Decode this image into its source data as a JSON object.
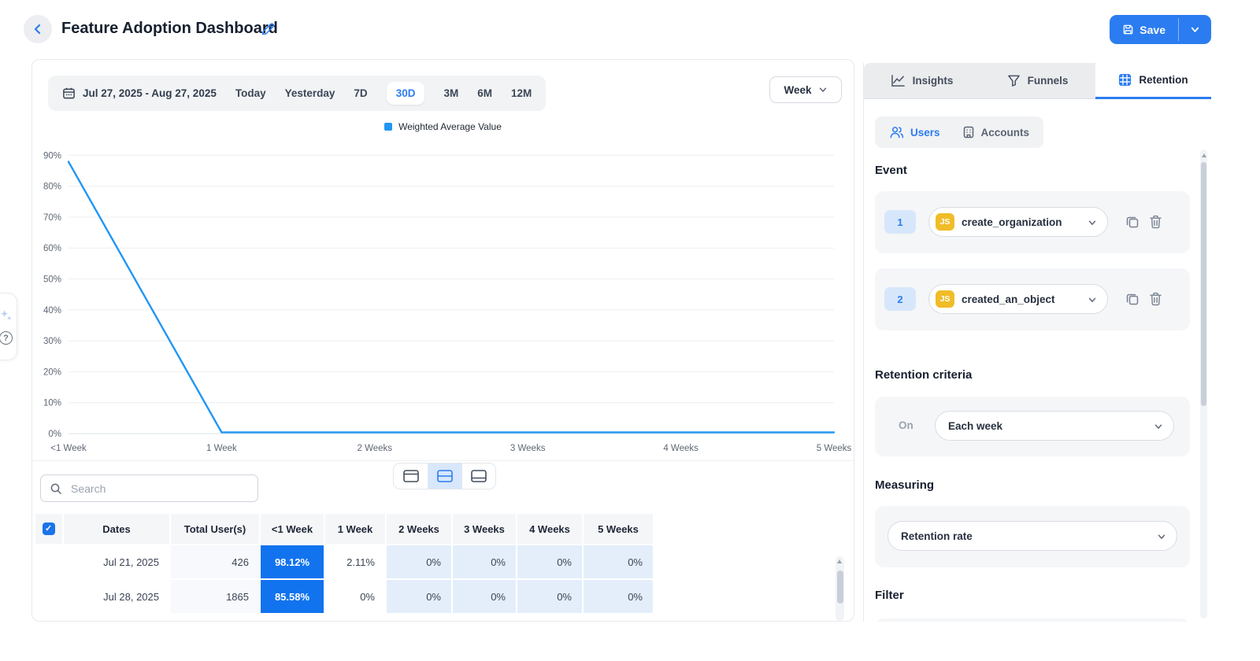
{
  "header": {
    "title": "Feature Adoption Dashboard",
    "save_label": "Save"
  },
  "toolbar": {
    "date_range": "Jul 27, 2025 - Aug 27, 2025",
    "presets": [
      "Today",
      "Yesterday",
      "7D",
      "30D",
      "3M",
      "6M",
      "12M"
    ],
    "active_preset": "30D",
    "granularity": "Week"
  },
  "legend": {
    "label": "Weighted Average Value",
    "color": "#2196f3"
  },
  "chart_data": {
    "type": "line",
    "title": "",
    "x": [
      "<1 Week",
      "1 Week",
      "2 Weeks",
      "3 Weeks",
      "4 Weeks",
      "5 Weeks"
    ],
    "series": [
      {
        "name": "Weighted Average Value",
        "color": "#2196f3",
        "values": [
          87.9,
          0.4,
          0.4,
          0.4,
          0.4,
          0.4
        ]
      }
    ],
    "ylim": [
      0,
      90
    ],
    "yticks": [
      "0%",
      "10%",
      "20%",
      "30%",
      "40%",
      "50%",
      "60%",
      "70%",
      "80%",
      "90%"
    ],
    "grid": true,
    "legend_position": "top-center"
  },
  "table": {
    "search_placeholder": "Search",
    "headers": [
      "Dates",
      "Total User(s)",
      "<1 Week",
      "1 Week",
      "2 Weeks",
      "3 Weeks",
      "4 Weeks",
      "5 Weeks"
    ],
    "rows": [
      {
        "date": "Jul 21, 2025",
        "total": "426",
        "cells": [
          "98.12%",
          "2.11%",
          "0%",
          "0%",
          "0%",
          "0%"
        ]
      },
      {
        "date": "Jul 28, 2025",
        "total": "1865",
        "cells": [
          "85.58%",
          "0%",
          "0%",
          "0%",
          "0%",
          "0%"
        ]
      }
    ]
  },
  "sidebar": {
    "tabs": [
      {
        "label": "Insights",
        "active": false
      },
      {
        "label": "Funnels",
        "active": false
      },
      {
        "label": "Retention",
        "active": true
      }
    ],
    "entity_toggle": {
      "options": [
        "Users",
        "Accounts"
      ],
      "active": "Users"
    },
    "event": {
      "heading": "Event",
      "items": [
        {
          "index": "1",
          "sdk": "JS",
          "name": "create_organization"
        },
        {
          "index": "2",
          "sdk": "JS",
          "name": "created_an_object"
        }
      ]
    },
    "retention_criteria": {
      "heading": "Retention criteria",
      "on_label": "On",
      "value": "Each week"
    },
    "measuring": {
      "heading": "Measuring",
      "value": "Retention rate"
    },
    "filter": {
      "heading": "Filter"
    }
  },
  "colors": {
    "accent": "#2b7cf0",
    "chart_line": "#2196f3",
    "heat_strong": "#1273ee",
    "heat_light": "#e4eefb",
    "js_badge": "#f0bd28"
  }
}
